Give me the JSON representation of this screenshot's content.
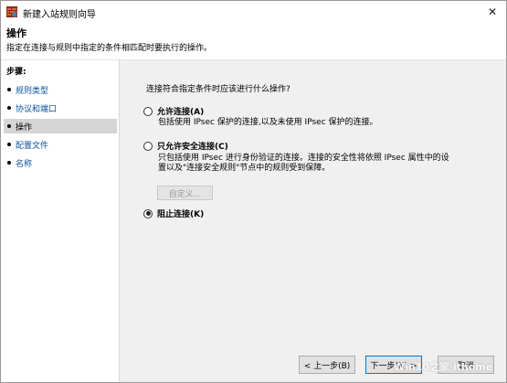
{
  "window": {
    "title": "新建入站规则向导",
    "close_glyph": "✕"
  },
  "header": {
    "title": "操作",
    "description": "指定在连接与规则中指定的条件相匹配时要执行的操作。"
  },
  "sidebar": {
    "steps_label": "步骤:",
    "steps": [
      {
        "label": "规则类型",
        "state": "done"
      },
      {
        "label": "协议和端口",
        "state": "done"
      },
      {
        "label": "操作",
        "state": "current"
      },
      {
        "label": "配置文件",
        "state": "todo"
      },
      {
        "label": "名称",
        "state": "todo"
      }
    ]
  },
  "main": {
    "question": "连接符合指定条件时应该进行什么操作?",
    "options": [
      {
        "label": "允许连接(A)",
        "desc_lines": [
          "包括使用 IPsec 保护的连接,以及未使用 IPsec 保护的连接。"
        ],
        "selected": false
      },
      {
        "label": "只允许安全连接(C)",
        "desc_lines": [
          "只包括使用 IPsec 进行身份验证的连接。连接的安全性将依照 IPsec 属性中的设",
          "置以及\"连接安全规则\"节点中的规则受到保障。"
        ],
        "selected": false
      },
      {
        "label": "阻止连接(K)",
        "desc_lines": [],
        "selected": true
      }
    ],
    "customize_label": "自定义..."
  },
  "buttons": {
    "back": "< 上一步(B)",
    "next": "下一步(N) >",
    "cancel": "取消"
  },
  "watermark": "Win10之家 ithome"
}
